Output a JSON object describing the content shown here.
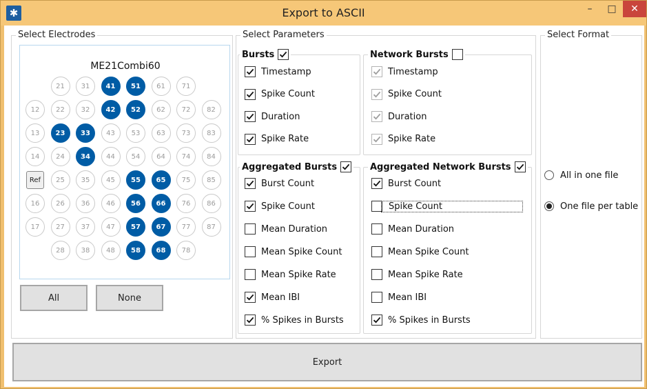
{
  "window": {
    "title": "Export to ASCII",
    "minimize": "–",
    "maximize": "□",
    "close": "✕"
  },
  "electrodes": {
    "title": "Select Electrodes",
    "mea_name": "ME21Combi60",
    "ref_label": "Ref",
    "rows": [
      [
        null,
        "21",
        "31",
        "41",
        "51",
        "61",
        "71",
        null
      ],
      [
        "12",
        "22",
        "32",
        "42",
        "52",
        "62",
        "72",
        "82"
      ],
      [
        "13",
        "23",
        "33",
        "43",
        "53",
        "63",
        "73",
        "83"
      ],
      [
        "14",
        "24",
        "34",
        "44",
        "54",
        "64",
        "74",
        "84"
      ],
      [
        "Ref",
        "25",
        "35",
        "45",
        "55",
        "65",
        "75",
        "85"
      ],
      [
        "16",
        "26",
        "36",
        "46",
        "56",
        "66",
        "76",
        "86"
      ],
      [
        "17",
        "27",
        "37",
        "47",
        "57",
        "67",
        "77",
        "87"
      ],
      [
        null,
        "28",
        "38",
        "48",
        "58",
        "68",
        "78",
        null
      ]
    ],
    "selected": [
      "41",
      "51",
      "42",
      "52",
      "23",
      "33",
      "34",
      "55",
      "65",
      "56",
      "66",
      "57",
      "67",
      "58",
      "68"
    ],
    "all_label": "All",
    "none_label": "None"
  },
  "parameters": {
    "title": "Select Parameters",
    "bursts": {
      "title": "Bursts",
      "checked": true,
      "items": [
        {
          "label": "Timestamp",
          "checked": true
        },
        {
          "label": "Spike Count",
          "checked": true
        },
        {
          "label": "Duration",
          "checked": true
        },
        {
          "label": "Spike Rate",
          "checked": true
        }
      ]
    },
    "network_bursts": {
      "title": "Network Bursts",
      "checked": false,
      "items": [
        {
          "label": "Timestamp",
          "checked": true,
          "disabled": true
        },
        {
          "label": "Spike Count",
          "checked": true,
          "disabled": true
        },
        {
          "label": "Duration",
          "checked": true,
          "disabled": true
        },
        {
          "label": "Spike Rate",
          "checked": true,
          "disabled": true
        }
      ]
    },
    "aggregated_bursts": {
      "title": "Aggregated Bursts",
      "checked": true,
      "items": [
        {
          "label": "Burst Count",
          "checked": true
        },
        {
          "label": "Spike Count",
          "checked": true
        },
        {
          "label": "Mean Duration",
          "checked": false
        },
        {
          "label": "Mean Spike Count",
          "checked": false
        },
        {
          "label": "Mean Spike Rate",
          "checked": false
        },
        {
          "label": "Mean IBI",
          "checked": true
        },
        {
          "label": "% Spikes in Bursts",
          "checked": true
        }
      ]
    },
    "aggregated_network_bursts": {
      "title": "Aggregated Network Bursts",
      "checked": true,
      "items": [
        {
          "label": "Burst Count",
          "checked": true
        },
        {
          "label": "Spike Count",
          "checked": false,
          "focused": true
        },
        {
          "label": "Mean Duration",
          "checked": false
        },
        {
          "label": "Mean Spike Count",
          "checked": false
        },
        {
          "label": "Mean Spike Rate",
          "checked": false
        },
        {
          "label": "Mean IBI",
          "checked": false
        },
        {
          "label": "% Spikes in Bursts",
          "checked": true
        }
      ]
    }
  },
  "format": {
    "title": "Select Format",
    "options": [
      {
        "label": "All in one file",
        "selected": false
      },
      {
        "label": "One file per table",
        "selected": true
      }
    ]
  },
  "export_label": "Export"
}
